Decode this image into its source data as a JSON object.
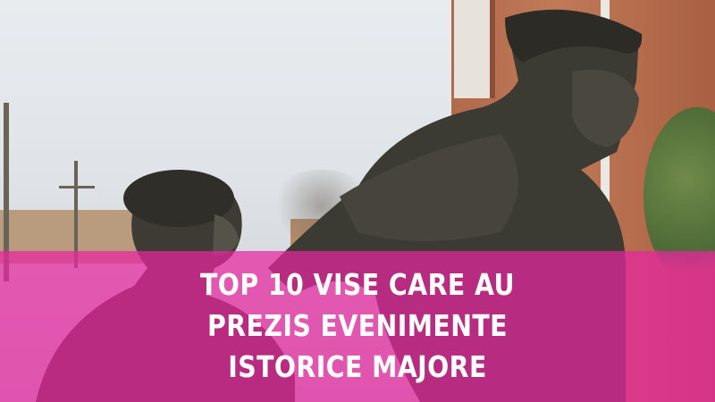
{
  "headline": {
    "lines": [
      "TOP 10 VISE CARE AU",
      "PREZIS EVENIMENTE",
      "ISTORICE MAJORE"
    ]
  },
  "colors": {
    "banner_overlay": "#E826A0",
    "headline_text": "#FFFFFF",
    "bronze": "#3b3a33",
    "brick": "#b06a4c"
  }
}
